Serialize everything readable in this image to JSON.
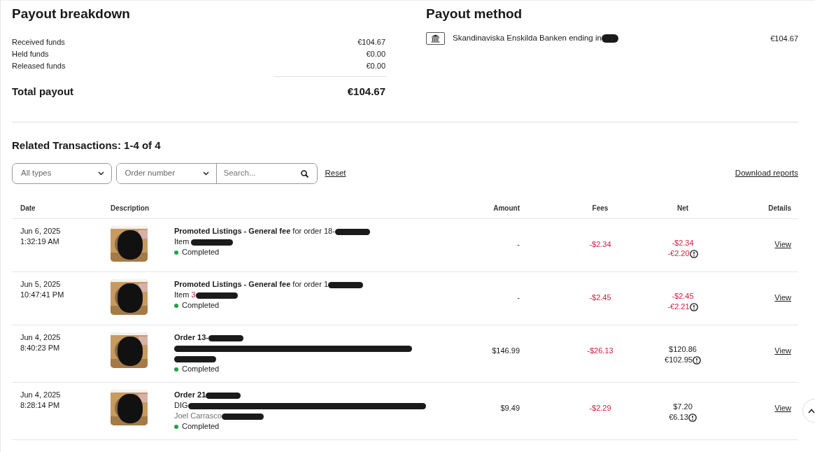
{
  "payout_breakdown": {
    "title": "Payout breakdown",
    "lines": [
      {
        "label": "Received funds",
        "value": "€104.67"
      },
      {
        "label": "Held funds",
        "value": "€0.00"
      },
      {
        "label": "Released funds",
        "value": "€0.00"
      }
    ],
    "total": {
      "label": "Total payout",
      "value": "€104.67"
    }
  },
  "payout_method": {
    "title": "Payout method",
    "bank": "Skandinaviska Enskilda Banken ending in",
    "redacted": true,
    "amount": "€104.67"
  },
  "transactions": {
    "title": "Related Transactions: 1-4 of 4",
    "filters": {
      "type_select": "All types",
      "field_select": "Order number",
      "search": {
        "placeholder": "Search..."
      },
      "reset": "Reset",
      "download": "Download reports"
    },
    "columns": [
      "Date",
      "Description",
      "Amount",
      "Fees",
      "Net",
      "Details"
    ],
    "rows": [
      {
        "date": "Jun 6, 2025",
        "time": "1:32:19 AM",
        "thumbnail": {
          "kind": "picture"
        },
        "lines": [
          {
            "kind": "title",
            "text": "**Promoted Listings - General fee** for order 18-",
            "redacted": true
          },
          {
            "kind": "item",
            "text": "Item ",
            "redacted": true
          }
        ],
        "status": "Completed",
        "amount": "-",
        "fees": "-$2.34",
        "net": "-$2.34",
        "net_eur": "-€2.20",
        "negative": true,
        "details": "View"
      },
      {
        "date": "Jun 5, 2025",
        "time": "10:47:41 PM",
        "thumbnail": {
          "kind": "picture"
        },
        "lines": [
          {
            "kind": "title",
            "text": "**Promoted Listings - General fee** for order 1",
            "redacted": true
          },
          {
            "kind": "item",
            "text": "Item ",
            "link": "3",
            "redacted": true
          }
        ],
        "status": "Completed",
        "amount": "-",
        "fees": "-$2.45",
        "net": "-$2.45",
        "net_eur": "-€2.21",
        "negative": true,
        "details": "View"
      },
      {
        "date": "Jun 4, 2025",
        "time": "8:40:23 PM",
        "thumbnail": {
          "kind": "picture"
        },
        "lines": [
          {
            "kind": "order",
            "text": "Order 13-",
            "redacted": true
          },
          {
            "kind": "product",
            "redacted": true
          },
          {
            "kind": "buyer",
            "redacted": true
          }
        ],
        "status": "Completed",
        "amount": "$146.99",
        "fees": "-$26.13",
        "net": "$120.86",
        "net_eur": "€102.95",
        "negative": false,
        "details": "View"
      },
      {
        "date": "Jun 4, 2025",
        "time": "8:28:14 PM",
        "thumbnail": {
          "kind": "picture"
        },
        "lines": [
          {
            "kind": "order",
            "text": "Order 21",
            "redacted": true
          },
          {
            "kind": "product",
            "text": "DIG",
            "redacted": true
          },
          {
            "kind": "buyer",
            "text": "Joel Carrasco",
            "redacted": true
          }
        ],
        "status": "Completed",
        "amount": "$9.49",
        "fees": "-$2.29",
        "net": "$7.20",
        "net_eur": "€6.13",
        "negative": false,
        "details": "View"
      }
    ]
  }
}
